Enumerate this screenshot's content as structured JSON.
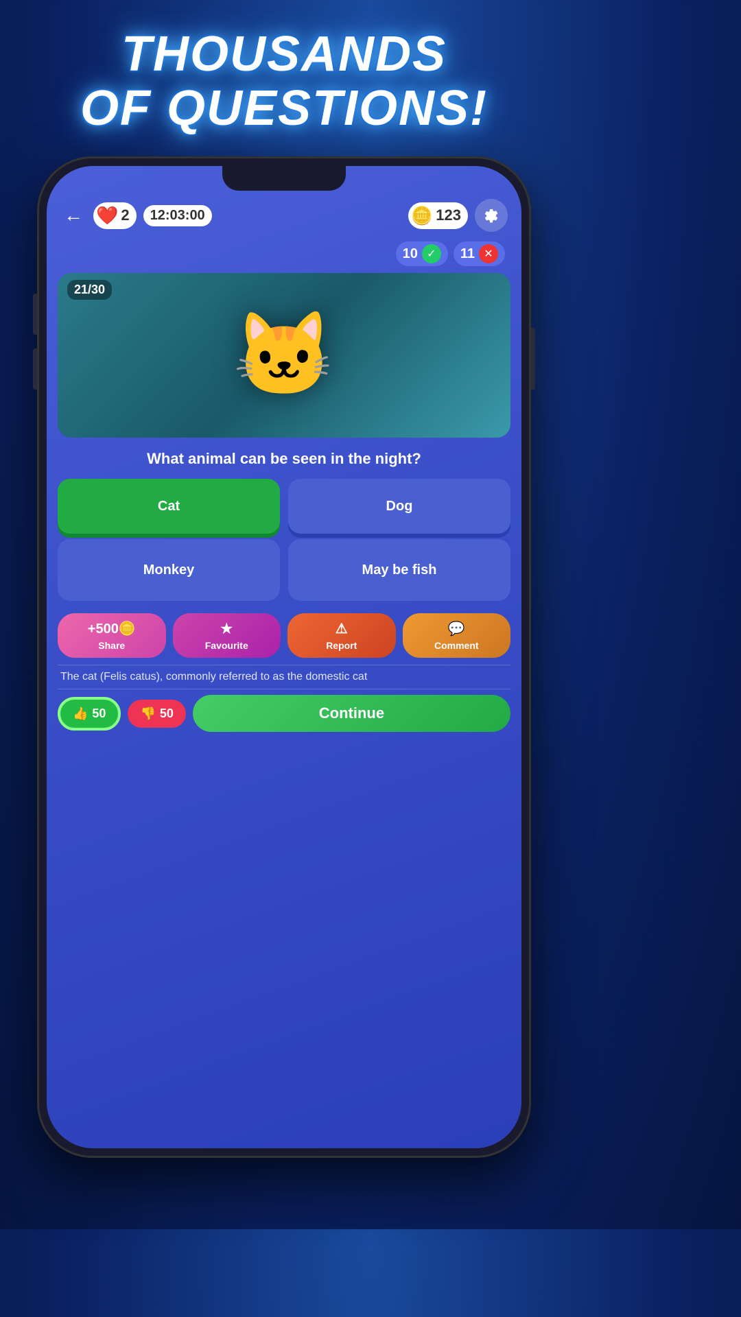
{
  "background": {
    "gradient_start": "#1a4a9e",
    "gradient_end": "#061540"
  },
  "title": {
    "line1": "THOUSANDS",
    "line2": "OF QUESTIONS!"
  },
  "header": {
    "back_label": "←",
    "lives_count": "2",
    "timer": "12:03:00",
    "coins": "123",
    "settings_label": "⚙"
  },
  "score": {
    "correct": "10",
    "incorrect": "11"
  },
  "question": {
    "counter": "21/30",
    "text": "What animal can be seen in the night?",
    "progress_percent": 70,
    "image_emoji": "🐱"
  },
  "answers": [
    {
      "id": "cat",
      "label": "Cat",
      "state": "correct"
    },
    {
      "id": "dog",
      "label": "Dog",
      "state": "normal"
    },
    {
      "id": "monkey",
      "label": "Monkey",
      "state": "normal"
    },
    {
      "id": "maybefish",
      "label": "May be fish",
      "state": "normal"
    }
  ],
  "actions": [
    {
      "id": "share",
      "icon": "+500🪙",
      "label": "Share",
      "class": "share-btn"
    },
    {
      "id": "favourite",
      "icon": "★",
      "label": "Favourite",
      "class": "fav-btn"
    },
    {
      "id": "report",
      "icon": "⚠",
      "label": "Report",
      "class": "report-btn"
    },
    {
      "id": "comment",
      "icon": "💬",
      "label": "Comment",
      "class": "comment-btn"
    }
  ],
  "info_text": "The cat (Felis catus), commonly referred to as the domestic cat",
  "bottom": {
    "thumbs_up_count": "50",
    "thumbs_down_count": "50",
    "continue_label": "Continue"
  }
}
